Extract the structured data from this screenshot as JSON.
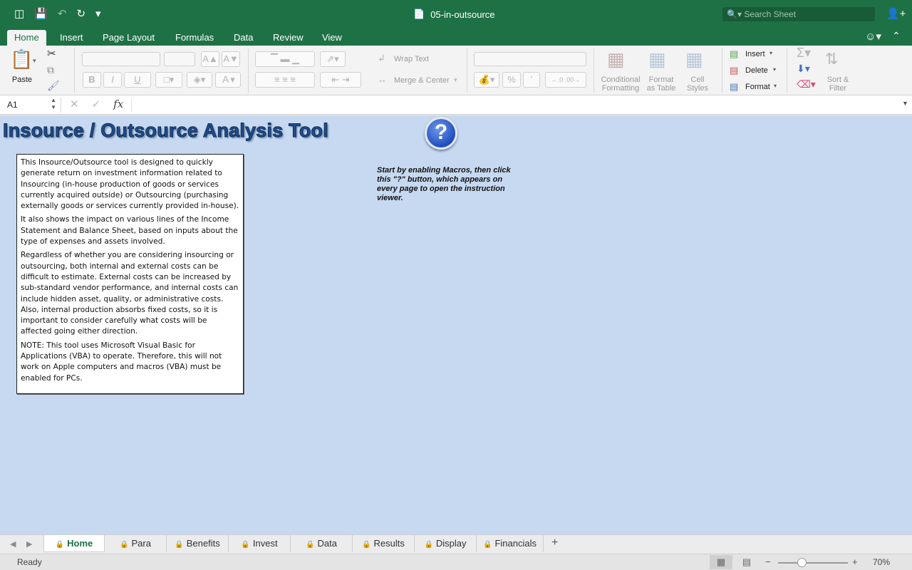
{
  "app": {
    "document_title": "05-in-outsource",
    "search_placeholder": "Search Sheet"
  },
  "ribbon_tabs": [
    {
      "label": "Home",
      "active": true
    },
    {
      "label": "Insert"
    },
    {
      "label": "Page Layout"
    },
    {
      "label": "Formulas"
    },
    {
      "label": "Data"
    },
    {
      "label": "Review"
    },
    {
      "label": "View"
    }
  ],
  "ribbon": {
    "paste": "Paste",
    "wrap_text": "Wrap Text",
    "merge_center": "Merge & Center",
    "percent": "%",
    "conditional_formatting_1": "Conditional",
    "conditional_formatting_2": "Formatting",
    "format_as_table_1": "Format",
    "format_as_table_2": "as Table",
    "cell_styles_1": "Cell",
    "cell_styles_2": "Styles",
    "insert": "Insert",
    "delete": "Delete",
    "format": "Format",
    "sort_filter_1": "Sort &",
    "sort_filter_2": "Filter",
    "bold": "B",
    "italic": "I",
    "underline": "U",
    "font_grow": "A",
    "font_shrink": "A"
  },
  "formula_bar": {
    "name_box": "A1",
    "fx": "fx",
    "value": ""
  },
  "sheet": {
    "title": "Insource / Outsource Analysis Tool",
    "help_button": "?",
    "paragraphs": [
      "This Insource/Outsource tool is designed to quickly generate return on investment information related to Insourcing (in-house production of goods or services currently acquired outside) or Outsourcing (purchasing externally goods or services currently provided in-house).",
      "It also shows the impact on various lines of the Income Statement and Balance Sheet, based on inputs about the type of expenses and assets involved.",
      "Regardless of whether you are considering insourcing or outsourcing, both internal and external costs can be difficult to estimate. External costs can be increased by sub-standard vendor performance, and internal costs can include hidden asset, quality, or administrative costs. Also, internal production absorbs fixed costs, so it is important to consider carefully what costs will be affected going either direction.",
      "NOTE: This tool uses Microsoft Visual Basic for Applications (VBA) to operate. Therefore, this will not work on Apple computers and macros (VBA) must be enabled for PCs."
    ],
    "instruction": "Start by enabling Macros, then click this \"?\" button, which appears on every page to open the instruction viewer."
  },
  "sheet_tabs": [
    {
      "label": "Home",
      "active": true
    },
    {
      "label": "Para"
    },
    {
      "label": "Benefits"
    },
    {
      "label": "Invest"
    },
    {
      "label": "Data"
    },
    {
      "label": "Results"
    },
    {
      "label": "Display"
    },
    {
      "label": "Financials"
    }
  ],
  "status": {
    "text": "Ready",
    "zoom": "70%",
    "zoom_fraction": 0.35
  },
  "icons": {
    "sidebar": "sidebar-icon",
    "save": "save-icon",
    "undo": "undo-icon",
    "redo": "redo-icon",
    "customize": "customize-icon",
    "search": "search-icon",
    "share": "add-person-icon",
    "lock": "lock-icon"
  }
}
